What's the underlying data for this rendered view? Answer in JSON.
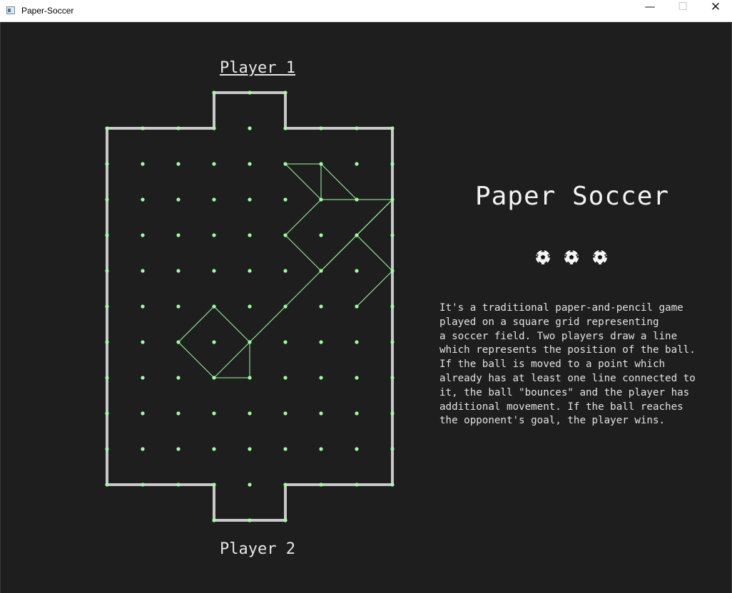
{
  "window": {
    "title": "Paper-Soccer",
    "minimize_glyph": "—",
    "maximize_glyph": "☐",
    "close_glyph": "✕"
  },
  "players": {
    "top": "Player 1",
    "bottom": "Player 2",
    "active": "top"
  },
  "info": {
    "title": "Paper Soccer",
    "ball_icons": [
      "soccer-ball-icon",
      "soccer-ball-icon",
      "soccer-ball-icon"
    ],
    "description": "It's a traditional paper-and-pencil game\nplayed on a square grid representing\na soccer field. Two players draw a line\nwhich represents the position of the ball.\nIf the ball is moved to a point which\nalready has at least one line connected to\nit, the ball \"bounces\" and the player has\nadditional movement. If the ball reaches\nthe opponent's goal, the player wins."
  },
  "board": {
    "columns": 9,
    "rows": 11,
    "goal_columns": [
      3,
      5
    ],
    "colors": {
      "border": "#c8c8c8",
      "dot": "#9cff9c",
      "line": "#9cff9c",
      "background": "#1e1e1e"
    },
    "moves": [
      [
        [
          6,
          1
        ],
        [
          6,
          2
        ]
      ],
      [
        [
          6,
          2
        ],
        [
          8,
          2
        ]
      ],
      [
        [
          8,
          2
        ],
        [
          6,
          4
        ]
      ],
      [
        [
          6,
          4
        ],
        [
          4,
          6
        ]
      ],
      [
        [
          4,
          6
        ],
        [
          3,
          7
        ]
      ],
      [
        [
          3,
          7
        ],
        [
          2,
          6
        ]
      ],
      [
        [
          2,
          6
        ],
        [
          3,
          5
        ]
      ],
      [
        [
          3,
          5
        ],
        [
          4,
          6
        ]
      ],
      [
        [
          4,
          6
        ],
        [
          4,
          7
        ]
      ],
      [
        [
          4,
          7
        ],
        [
          3,
          7
        ]
      ],
      [
        [
          6,
          1
        ],
        [
          7,
          2
        ]
      ],
      [
        [
          7,
          2
        ],
        [
          8,
          2
        ]
      ],
      [
        [
          8,
          2
        ],
        [
          7,
          3
        ]
      ],
      [
        [
          7,
          3
        ],
        [
          8,
          4
        ]
      ],
      [
        [
          8,
          4
        ],
        [
          7,
          5
        ]
      ],
      [
        [
          7,
          3
        ],
        [
          6,
          4
        ]
      ],
      [
        [
          6,
          4
        ],
        [
          5,
          3
        ]
      ],
      [
        [
          5,
          3
        ],
        [
          6,
          2
        ]
      ],
      [
        [
          6,
          2
        ],
        [
          5,
          1
        ]
      ],
      [
        [
          5,
          1
        ],
        [
          6,
          1
        ]
      ]
    ]
  }
}
